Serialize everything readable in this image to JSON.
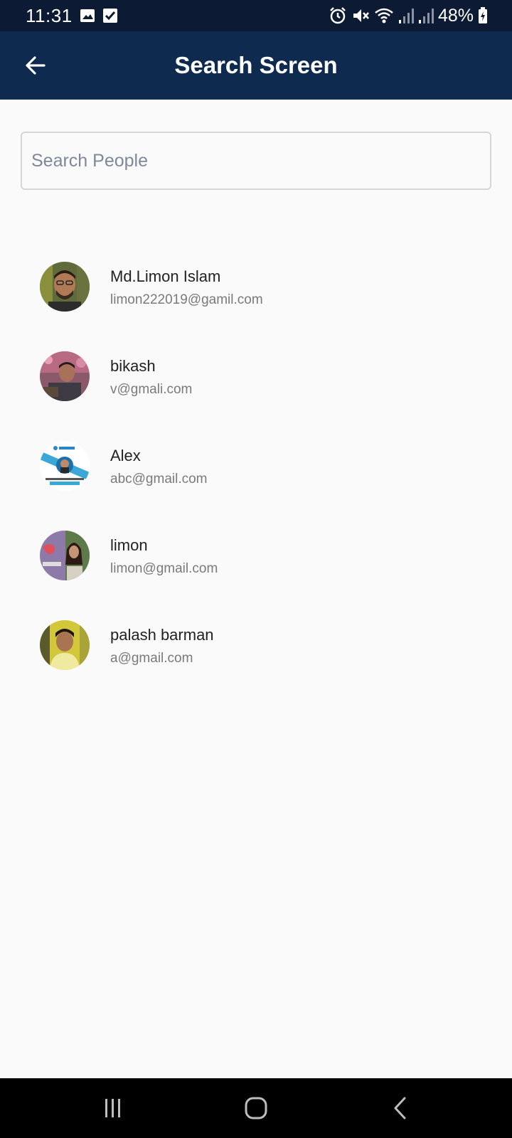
{
  "status_bar": {
    "time": "11:31",
    "battery": "48%",
    "icons": [
      "image-icon",
      "check-box-icon",
      "alarm-icon",
      "mute-icon",
      "wifi-icon",
      "signal-icon",
      "signal-icon",
      "battery-charging-icon"
    ]
  },
  "app_bar": {
    "title": "Search Screen",
    "back_icon": "arrow-back-icon",
    "background": "#0f2a4f"
  },
  "search": {
    "placeholder": "Search People",
    "value": ""
  },
  "people": [
    {
      "name": "Md.Limon Islam",
      "email": "limon222019@gamil.com"
    },
    {
      "name": "bikash",
      "email": "v@gmali.com"
    },
    {
      "name": "Alex",
      "email": "abc@gmail.com"
    },
    {
      "name": "limon",
      "email": "limon@gmail.com"
    },
    {
      "name": "palash barman",
      "email": "a@gmail.com"
    }
  ],
  "nav_bar": {
    "icons": [
      "recent-apps-icon",
      "home-icon",
      "back-icon"
    ]
  },
  "colors": {
    "status_bar": "#0c1a33",
    "app_bar": "#0f2a4f",
    "background": "#fafafa"
  }
}
